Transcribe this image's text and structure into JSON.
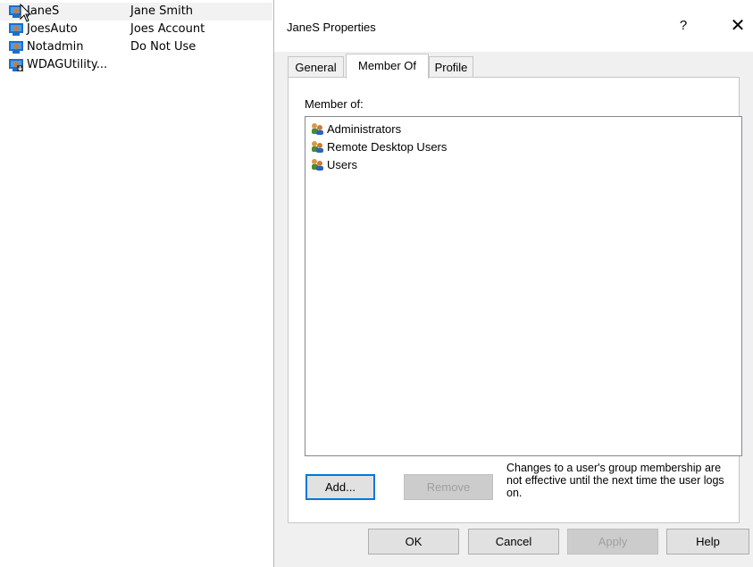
{
  "users": [
    {
      "name": "JaneS",
      "full_name": "Jane Smith",
      "selected": true
    },
    {
      "name": "JoesAuto",
      "full_name": "Joes Account"
    },
    {
      "name": "Notadmin",
      "full_name": "Do Not Use"
    },
    {
      "name": "WDAGUtility...",
      "full_name": ""
    }
  ],
  "dialog": {
    "title": "JaneS Properties",
    "help_label": "?",
    "close_label": "✕",
    "tabs": [
      {
        "label": "General"
      },
      {
        "label": "Member Of",
        "active": true
      },
      {
        "label": "Profile"
      }
    ],
    "member_of_label": "Member of:",
    "groups": [
      "Administrators",
      "Remote Desktop Users",
      "Users"
    ],
    "add_label": "Add...",
    "remove_label": "Remove",
    "note": "Changes to a user's group membership are not effective until the next time the user logs on.",
    "ok_label": "OK",
    "cancel_label": "Cancel",
    "apply_label": "Apply",
    "help_button_label": "Help"
  },
  "icons": {
    "user": "user-icon",
    "group": "group-icon",
    "cursor": "mouse-pointer-icon"
  },
  "colors": {
    "accent": "#0078d7",
    "dialog_bg": "#f0f0f0",
    "disabled_text": "#a0a0a0"
  }
}
